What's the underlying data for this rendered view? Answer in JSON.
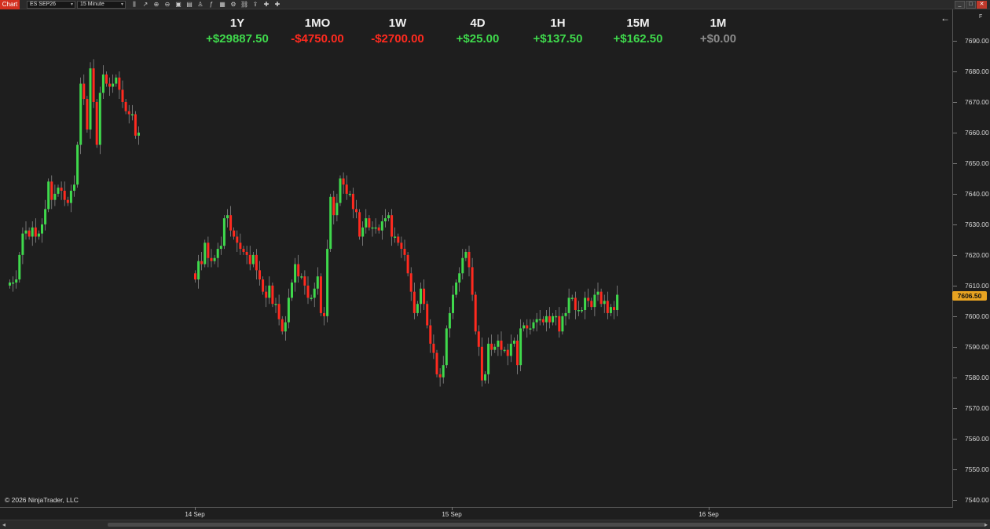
{
  "toolbar": {
    "chart_tab": "Chart",
    "instrument": "ES SEP26",
    "interval": "15 Minute",
    "icons": [
      "bar-type-icon",
      "draw-line-icon",
      "zoom-in-icon",
      "zoom-out-icon",
      "data-box-icon",
      "bar-style-icon",
      "strategies-icon",
      "indicators-icon",
      "templates-icon",
      "properties-icon",
      "attach-icon",
      "share-icon",
      "pin-icon",
      "pin-icon"
    ],
    "window_buttons": {
      "minimize": "_",
      "maximize": "□",
      "close": "✕"
    }
  },
  "performance": [
    {
      "label": "1Y",
      "value": "+$29887.50",
      "color": "#3fd94c"
    },
    {
      "label": "1MO",
      "value": "-$4750.00",
      "color": "#ff2a1f"
    },
    {
      "label": "1W",
      "value": "-$2700.00",
      "color": "#ff2a1f"
    },
    {
      "label": "4D",
      "value": "+$25.00",
      "color": "#3fd94c"
    },
    {
      "label": "1H",
      "value": "+$137.50",
      "color": "#3fd94c"
    },
    {
      "label": "15M",
      "value": "+$162.50",
      "color": "#3fd94c"
    },
    {
      "label": "1M",
      "value": "+$0.00",
      "color": "#8a8a8a"
    }
  ],
  "price_axis": {
    "labels": [
      "7690.00",
      "7680.00",
      "7670.00",
      "7660.00",
      "7650.00",
      "7640.00",
      "7630.00",
      "7620.00",
      "7610.00",
      "7600.00",
      "7590.00",
      "7580.00",
      "7570.00",
      "7560.00",
      "7550.00",
      "7540.00"
    ],
    "last_price": "7606.50",
    "last_price_color": "#e8a321",
    "nav_icon": "back-arrow-icon",
    "corner_label": "F"
  },
  "time_axis": {
    "labels": [
      "14 Sep",
      "15 Sep",
      "16 Sep"
    ]
  },
  "copyright": "© 2026 NinjaTrader, LLC",
  "colors": {
    "up": "#3fd94c",
    "down": "#ff2a1f",
    "wick": "#aaaaaa"
  },
  "chart_data": {
    "type": "candlestick",
    "instrument": "ES SEP26",
    "interval": "15 Minute",
    "y_range": [
      7535,
      7695
    ],
    "segments": [
      {
        "start_time_x": 0.0,
        "closes": [
          7611,
          7611,
          7612,
          7620,
          7627,
          7628,
          7626,
          7629,
          7626,
          7627,
          7630,
          7635,
          7644,
          7638,
          7640,
          7642,
          7641,
          7638,
          7637,
          7641,
          7643,
          7656,
          7676,
          7671,
          7661,
          7681,
          7670,
          7656,
          7673,
          7679,
          7676,
          7675,
          7676,
          7678,
          7674,
          7670,
          7667,
          7666,
          7666,
          7659,
          7660
        ]
      },
      {
        "start_time_x": 1.0,
        "closes": [
          7612,
          7618,
          7617,
          7624,
          7619,
          7618,
          7619,
          7622,
          7623,
          7632,
          7633,
          7628,
          7626,
          7624,
          7622,
          7621,
          7620,
          7617,
          7620,
          7615,
          7612,
          7608,
          7606,
          7610,
          7604,
          7604,
          7599,
          7595,
          7598,
          7606,
          7611,
          7617,
          7613,
          7613,
          7610,
          7606,
          7606,
          7609,
          7613,
          7601,
          7600,
          7622,
          7639,
          7633,
          7637,
          7645,
          7643,
          7640,
          7640,
          7635,
          7634,
          7626,
          7629,
          7632,
          7629,
          7629,
          7629,
          7628,
          7631,
          7632,
          7633,
          7626,
          7626,
          7624,
          7622,
          7620,
          7614,
          7608,
          7601,
          7604,
          7609,
          7604,
          7597,
          7591,
          7588,
          7581,
          7580,
          7584,
          7596,
          7601,
          7607,
          7611,
          7614,
          7619,
          7621,
          7616,
          7607,
          7595,
          7590,
          7579,
          7581,
          7591,
          7589,
          7590,
          7592,
          7589,
          7589,
          7587,
          7591,
          7592,
          7584,
          7596,
          7597,
          7596,
          7596,
          7598,
          7599,
          7599,
          7598,
          7600,
          7598,
          7600,
          7600,
          7595,
          7600,
          7601,
          7606,
          7606,
          7602,
          7602,
          7602,
          7606,
          7605,
          7603,
          7607,
          7608,
          7604,
          7605,
          7601,
          7603,
          7602,
          7607
        ]
      }
    ],
    "last_price": 7606.5
  }
}
